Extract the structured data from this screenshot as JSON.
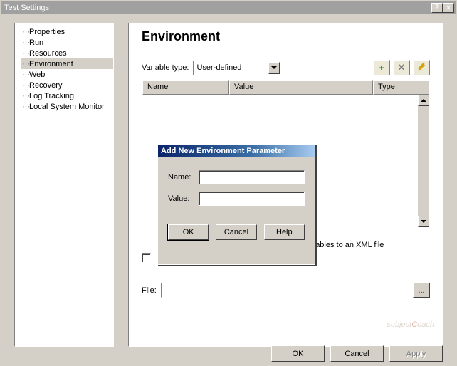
{
  "window": {
    "title": "Test Settings"
  },
  "tree": {
    "items": [
      {
        "label": "Properties"
      },
      {
        "label": "Run"
      },
      {
        "label": "Resources"
      },
      {
        "label": "Environment"
      },
      {
        "label": "Web"
      },
      {
        "label": "Recovery"
      },
      {
        "label": "Log Tracking"
      },
      {
        "label": "Local System Monitor"
      }
    ],
    "selected": "Environment"
  },
  "main": {
    "heading": "Environment",
    "variable_type_label": "Variable type:",
    "variable_type_value": "User-defined",
    "columns": {
      "name": "Name",
      "value": "Value",
      "type": "Type"
    },
    "export_text": "nent variables to an XML file",
    "file_label": "File:",
    "file_value": "",
    "browse_label": "..."
  },
  "footer": {
    "ok": "OK",
    "cancel": "Cancel",
    "apply": "Apply"
  },
  "modal": {
    "title": "Add New Environment Parameter",
    "name_label": "Name:",
    "name_value": "",
    "value_label": "Value:",
    "value_value": "",
    "ok": "OK",
    "cancel": "Cancel",
    "help": "Help"
  },
  "watermark": {
    "p1": "subject",
    "p2": "C",
    "p3": "oach"
  }
}
